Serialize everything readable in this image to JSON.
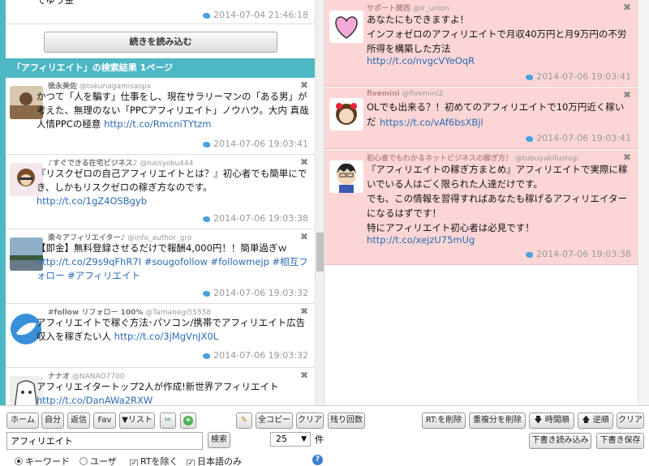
{
  "left": {
    "top_time": "2014-07-04 21:46:18",
    "top_snippet": "でゆう金",
    "load_more": "続きを読み込む",
    "result_header": "「アフィリエイト」の検索結果 1ページ",
    "tweets": [
      {
        "name": "徳永美佐",
        "handle": "@tokunagamisaspx",
        "text": "かつて「人を騙す」仕事をし、現在サラリーマンの「ある男」が考えた、無理のない「PPCアフィリエイト」ノウハウ。大内 真哉 人情PPCの極意 ",
        "link": "http://t.co/RmcniTYtzm",
        "time": "2014-07-06 19:03:41"
      },
      {
        "name": "♪すぐできる在宅ビジネス♪",
        "handle": "@naisyoku444",
        "text": "『リスクゼロの自己アフィリエイトとは？』初心者でも簡単にでき、しかもリスクゼロの稼ぎ方なのです。",
        "link": "http://t.co/1gZ4OSBgyb",
        "time": "2014-07-06 19:03:38"
      },
      {
        "name": "楽々アフィリエイター♪",
        "handle": "@info_author_gro",
        "text": "【即金】無料登録させるだけで報酬4,000円！！簡単過ぎｗ ",
        "link": "http://t.co/Z9s9qFhR7I",
        "tags": " #sougofollow #followmejp #相互フォロー #アフィリエイト",
        "time": "2014-07-06 19:03:32"
      },
      {
        "name": "#follow リフォロー 100%",
        "handle": "@Tamanegi55558",
        "text": "アフィリエイトで稼ぐ方法･パソコン/携帯でアフィリエイト広告収入を稼ぎたい人 ",
        "link": "http://t.co/3jMgVnJX0L",
        "time": "2014-07-06 19:03:32"
      },
      {
        "name": "ナナオ",
        "handle": "@NANAO7700",
        "text": "アフィリエイタートップ2人が作成!新世界アフィリエイト",
        "link": "http://t.co/DanAWa2RXW",
        "time": ""
      }
    ]
  },
  "right": {
    "tweets": [
      {
        "name": "サポート関西",
        "handle": "@ir_union",
        "text": "あなたにもできますよ！\nインフォゼロのアフィリエイトで月収40万円と月9万円の不労所得を構築した方法",
        "link": "http://t.co/nvgcVYeOqR",
        "time": "2014-07-06 19:03:41"
      },
      {
        "name": "fivemini",
        "handle": "@fivemini2",
        "text": "OLでも出来る？！初めてのアフィリエイトで10万円近く稼いだ",
        "link": "https://t.co/vAf6bsXBjl",
        "time": "2014-07-06 19:03:41"
      },
      {
        "name": "初心者でもわかるネットビジネスの稼ぎ方！",
        "handle": "@tubuyakifushigi",
        "text": "『アフィリエイトの稼ぎ方まとめ』アフィリエイトで実際に稼いでいる人はごく限られた人達だけです。\nでも、この情報を習得すればあなたも稼げるアフィリエイターになるはずです！\n特にアフィリエイト初心者は必見です！",
        "link": "http://t.co/xejzU75mUg",
        "time": "2014-07-06 19:03:38"
      }
    ]
  },
  "toolbar": {
    "home": "ホーム",
    "self": "自分",
    "reply": "返信",
    "fav": "Fav",
    "list": "▼リスト",
    "all_copy": "全コピー",
    "clear": "クリア",
    "remaining": "残り回数",
    "rt_delete": "RT:を削除",
    "dup_delete": "重複分を削除",
    "time_order": "時間順",
    "reverse_order": "逆順",
    "clear2": "クリア",
    "search_value": "アフィリエイト",
    "search_btn": "検索",
    "count_value": "25",
    "count_unit": "件",
    "keyword": "キーワード",
    "user": "ユーザ",
    "exclude_rt": "RTを除く",
    "japanese_only": "日本語のみ",
    "load_draft": "下書き読み込み",
    "save_draft": "下書き保存"
  }
}
